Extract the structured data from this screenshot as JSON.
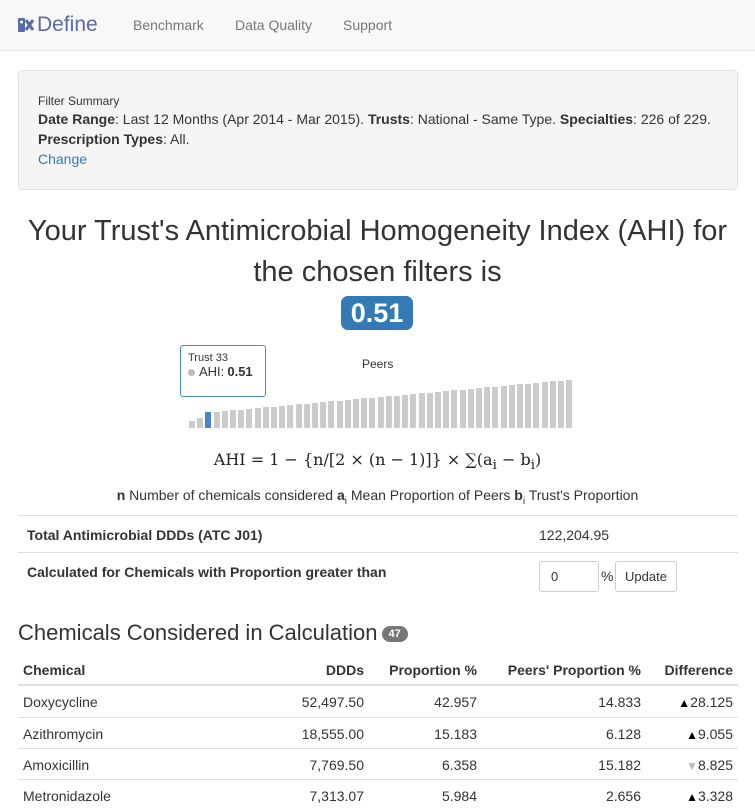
{
  "brand": {
    "name": "Define"
  },
  "nav": {
    "items": [
      "Benchmark",
      "Data Quality",
      "Support"
    ]
  },
  "filter": {
    "title": "Filter Summary",
    "date_range_label": "Date Range",
    "date_range_value": ": Last 12 Months (Apr 2014 - Mar 2015).",
    "trusts_label": "Trusts",
    "trusts_value": ": National - Same Type.",
    "specialties_label": "Specialties",
    "specialties_value": ": 226 of 229.",
    "prescription_label": "Prescription Types",
    "prescription_value": ": All.",
    "change_link": "Change"
  },
  "headline": {
    "line1": "Your Trust's Antimicrobial Homogeneity Index (AHI) for",
    "line2": "the chosen filters is",
    "ahi_value": "0.51"
  },
  "chart_data": {
    "type": "bar",
    "title": "Peers",
    "highlighted_index": 2,
    "values": [
      0.4,
      0.44,
      0.51,
      0.52,
      0.53,
      0.54,
      0.55,
      0.56,
      0.57,
      0.58,
      0.59,
      0.6,
      0.61,
      0.62,
      0.63,
      0.64,
      0.65,
      0.66,
      0.67,
      0.68,
      0.69,
      0.7,
      0.71,
      0.72,
      0.73,
      0.74,
      0.75,
      0.76,
      0.77,
      0.78,
      0.79,
      0.8,
      0.81,
      0.82,
      0.83,
      0.84,
      0.85,
      0.86,
      0.87,
      0.88,
      0.89,
      0.9,
      0.91,
      0.92,
      0.93,
      0.94,
      0.95
    ],
    "tooltip": {
      "name": "Trust 33",
      "label": "AHI:",
      "value": "0.51"
    }
  },
  "formula": {
    "text": "AHI = 1 − {n/[2 × (n − 1)]} × ∑(a",
    "tail": " − b",
    "end": ")"
  },
  "legend": {
    "n_label": "n",
    "n_text": " Number of chemicals considered ",
    "a_label": "a",
    "a_sub": "i",
    "a_text": " Mean Proportion of Peers ",
    "b_label": "b",
    "b_sub": "i",
    "b_text": " Trust's Proportion"
  },
  "totals": {
    "ddd_label": "Total Antimicrobial DDDs (ATC J01)",
    "ddd_value": "122,204.95",
    "threshold_label": "Calculated for Chemicals with Proportion greater than",
    "threshold_value": "0",
    "pct_symbol": "%",
    "update_button": "Update"
  },
  "chemicals": {
    "title": "Chemicals Considered in Calculation",
    "count": "47",
    "headers": [
      "Chemical",
      "DDDs",
      "Proportion %",
      "Peers' Proportion %",
      "Difference"
    ],
    "rows": [
      {
        "name": "Doxycycline",
        "ddds": "52,497.50",
        "prop": "42.957",
        "peers": "14.833",
        "arrow": "▲",
        "diff": "28.125",
        "dir": "up"
      },
      {
        "name": "Azithromycin",
        "ddds": "18,555.00",
        "prop": "15.183",
        "peers": "6.128",
        "arrow": "▲",
        "diff": "9.055",
        "dir": "up"
      },
      {
        "name": "Amoxicillin",
        "ddds": "7,769.50",
        "prop": "6.358",
        "peers": "15.182",
        "arrow": "▼",
        "diff": "8.825",
        "dir": "down"
      },
      {
        "name": "Metronidazole",
        "ddds": "7,313.07",
        "prop": "5.984",
        "peers": "2.656",
        "arrow": "▲",
        "diff": "3.328",
        "dir": "up"
      }
    ]
  },
  "colors": {
    "accent": "#337ab7",
    "bar": "#cccccc",
    "bar_active": "#4a86c8",
    "brand": "#5a6aa8"
  }
}
